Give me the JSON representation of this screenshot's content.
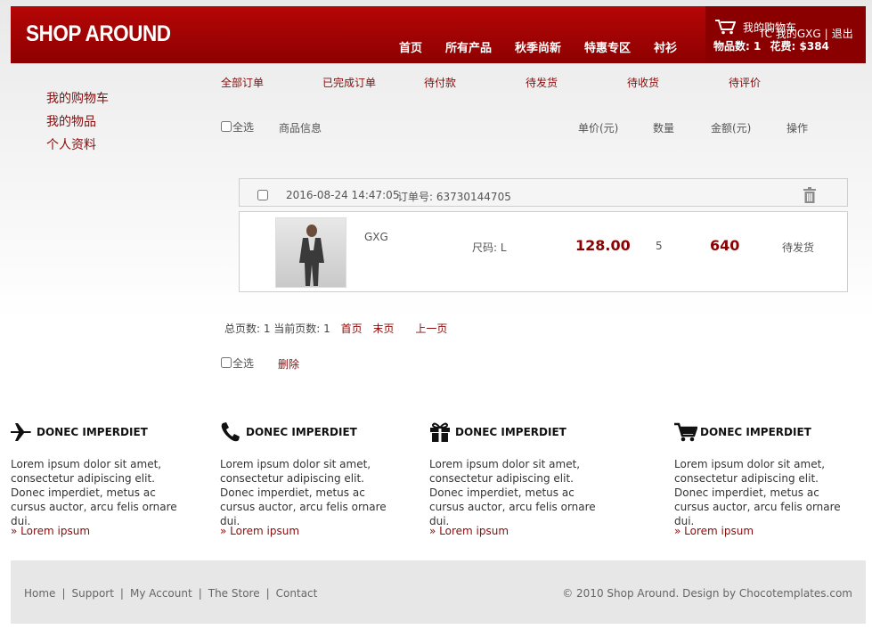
{
  "header": {
    "logo": "SHOP AROUND",
    "nav": [
      "首页",
      "所有产品",
      "秋季尚新",
      "特惠专区",
      "衬衫"
    ],
    "cart_label": "我的购物车",
    "user_greeting": "TC 我的GXG",
    "logout": "退出",
    "item_count_label": "物品数: 1",
    "spend_label": "花费: $384"
  },
  "sidebar": {
    "items": [
      "我的购物车",
      "我的物品",
      "个人资料"
    ]
  },
  "tabs": [
    "全部订单",
    "已完成订单",
    "待付款",
    "待发货",
    "待收货",
    "待评价"
  ],
  "table_header": {
    "select_all": "全选",
    "product_info": "商品信息",
    "unit_price": "单价(元)",
    "quantity": "数量",
    "amount": "金额(元)",
    "action": "操作"
  },
  "order": {
    "date": "2016-08-24 14:47:05",
    "order_no_label": "订单号: 63730144705",
    "item_name": "GXG",
    "size": "尺码: L",
    "unit_price": "128.00",
    "quantity": "5",
    "amount": "640",
    "status": "待发货"
  },
  "pager": {
    "summary": "总页数: 1 当前页数: 1",
    "first": "首页",
    "last": "末页",
    "prev": "上一页"
  },
  "bulk": {
    "select_all": "全选",
    "delete": "删除"
  },
  "features": [
    {
      "icon": "airplane-icon",
      "title": "DONEC IMPERDIET",
      "text": "Lorem ipsum dolor sit amet, consectetur adipiscing elit. Donec imperdiet, metus ac cursus auctor, arcu felis ornare dui.",
      "link": "» Lorem ipsum"
    },
    {
      "icon": "phone-icon",
      "title": "DONEC IMPERDIET",
      "text": "Lorem ipsum dolor sit amet, consectetur adipiscing elit. Donec imperdiet, metus ac cursus auctor, arcu felis ornare dui.",
      "link": "» Lorem ipsum"
    },
    {
      "icon": "gift-icon",
      "title": "DONEC IMPERDIET",
      "text": "Lorem ipsum dolor sit amet, consectetur adipiscing elit. Donec imperdiet, metus ac cursus auctor, arcu felis ornare dui.",
      "link": "» Lorem ipsum"
    },
    {
      "icon": "cart-icon",
      "title": "DONEC IMPERDIET",
      "text": "Lorem ipsum dolor sit amet, consectetur adipiscing elit. Donec imperdiet, metus ac cursus auctor, arcu felis ornare dui.",
      "link": "» Lorem ipsum"
    }
  ],
  "footer": {
    "links": [
      "Home",
      "Support",
      "My Account",
      "The Store",
      "Contact"
    ],
    "copyright": "© 2010 Shop Around. Design by Chocotemplates.com"
  },
  "colors": {
    "brand_red": "#a80000",
    "link_red": "#8b0a0a"
  }
}
